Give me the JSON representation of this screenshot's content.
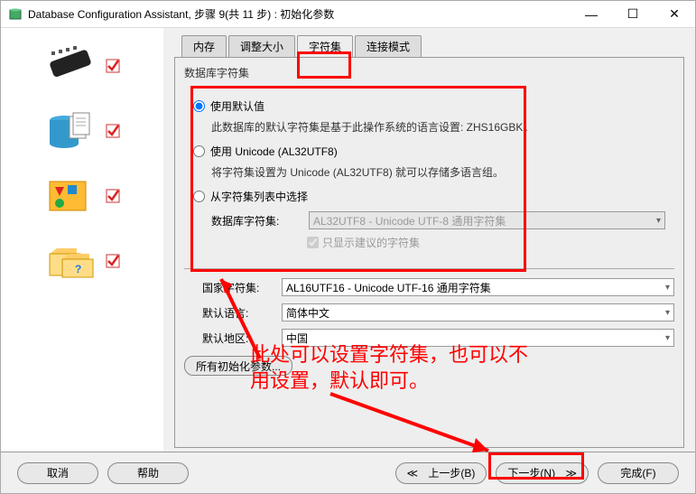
{
  "title": "Database Configuration Assistant, 步骤 9(共 11 步) : 初始化参数",
  "tabs": {
    "memory": "内存",
    "sizing": "调整大小",
    "charset": "字符集",
    "connmode": "连接模式"
  },
  "group": {
    "title": "数据库字符集",
    "r1_label": "使用默认值",
    "r1_desc": "此数据库的默认字符集是基于此操作系统的语言设置: ZHS16GBK。",
    "r2_label": "使用 Unicode (AL32UTF8)",
    "r2_desc": "将字符集设置为 Unicode (AL32UTF8) 就可以存储多语言组。",
    "r3_label": "从字符集列表中选择",
    "db_cs_label": "数据库字符集:",
    "db_cs_value": "AL32UTF8 - Unicode UTF-8 通用字符集",
    "cb_label": "只显示建议的字符集"
  },
  "nat_cs_label": "国家字符集:",
  "nat_cs_value": "AL16UTF16 - Unicode UTF-16 通用字符集",
  "def_lang_label": "默认语言:",
  "def_lang_value": "简体中文",
  "def_region_label": "默认地区:",
  "def_region_value": "中国",
  "all_params": "所有初始化参数...",
  "footer": {
    "cancel": "取消",
    "help": "帮助",
    "back": "上一步(B)",
    "next": "下一步(N)",
    "finish": "完成(F)"
  },
  "annotation": "此处可以设置字符集，也可以不用设置，默认即可。"
}
